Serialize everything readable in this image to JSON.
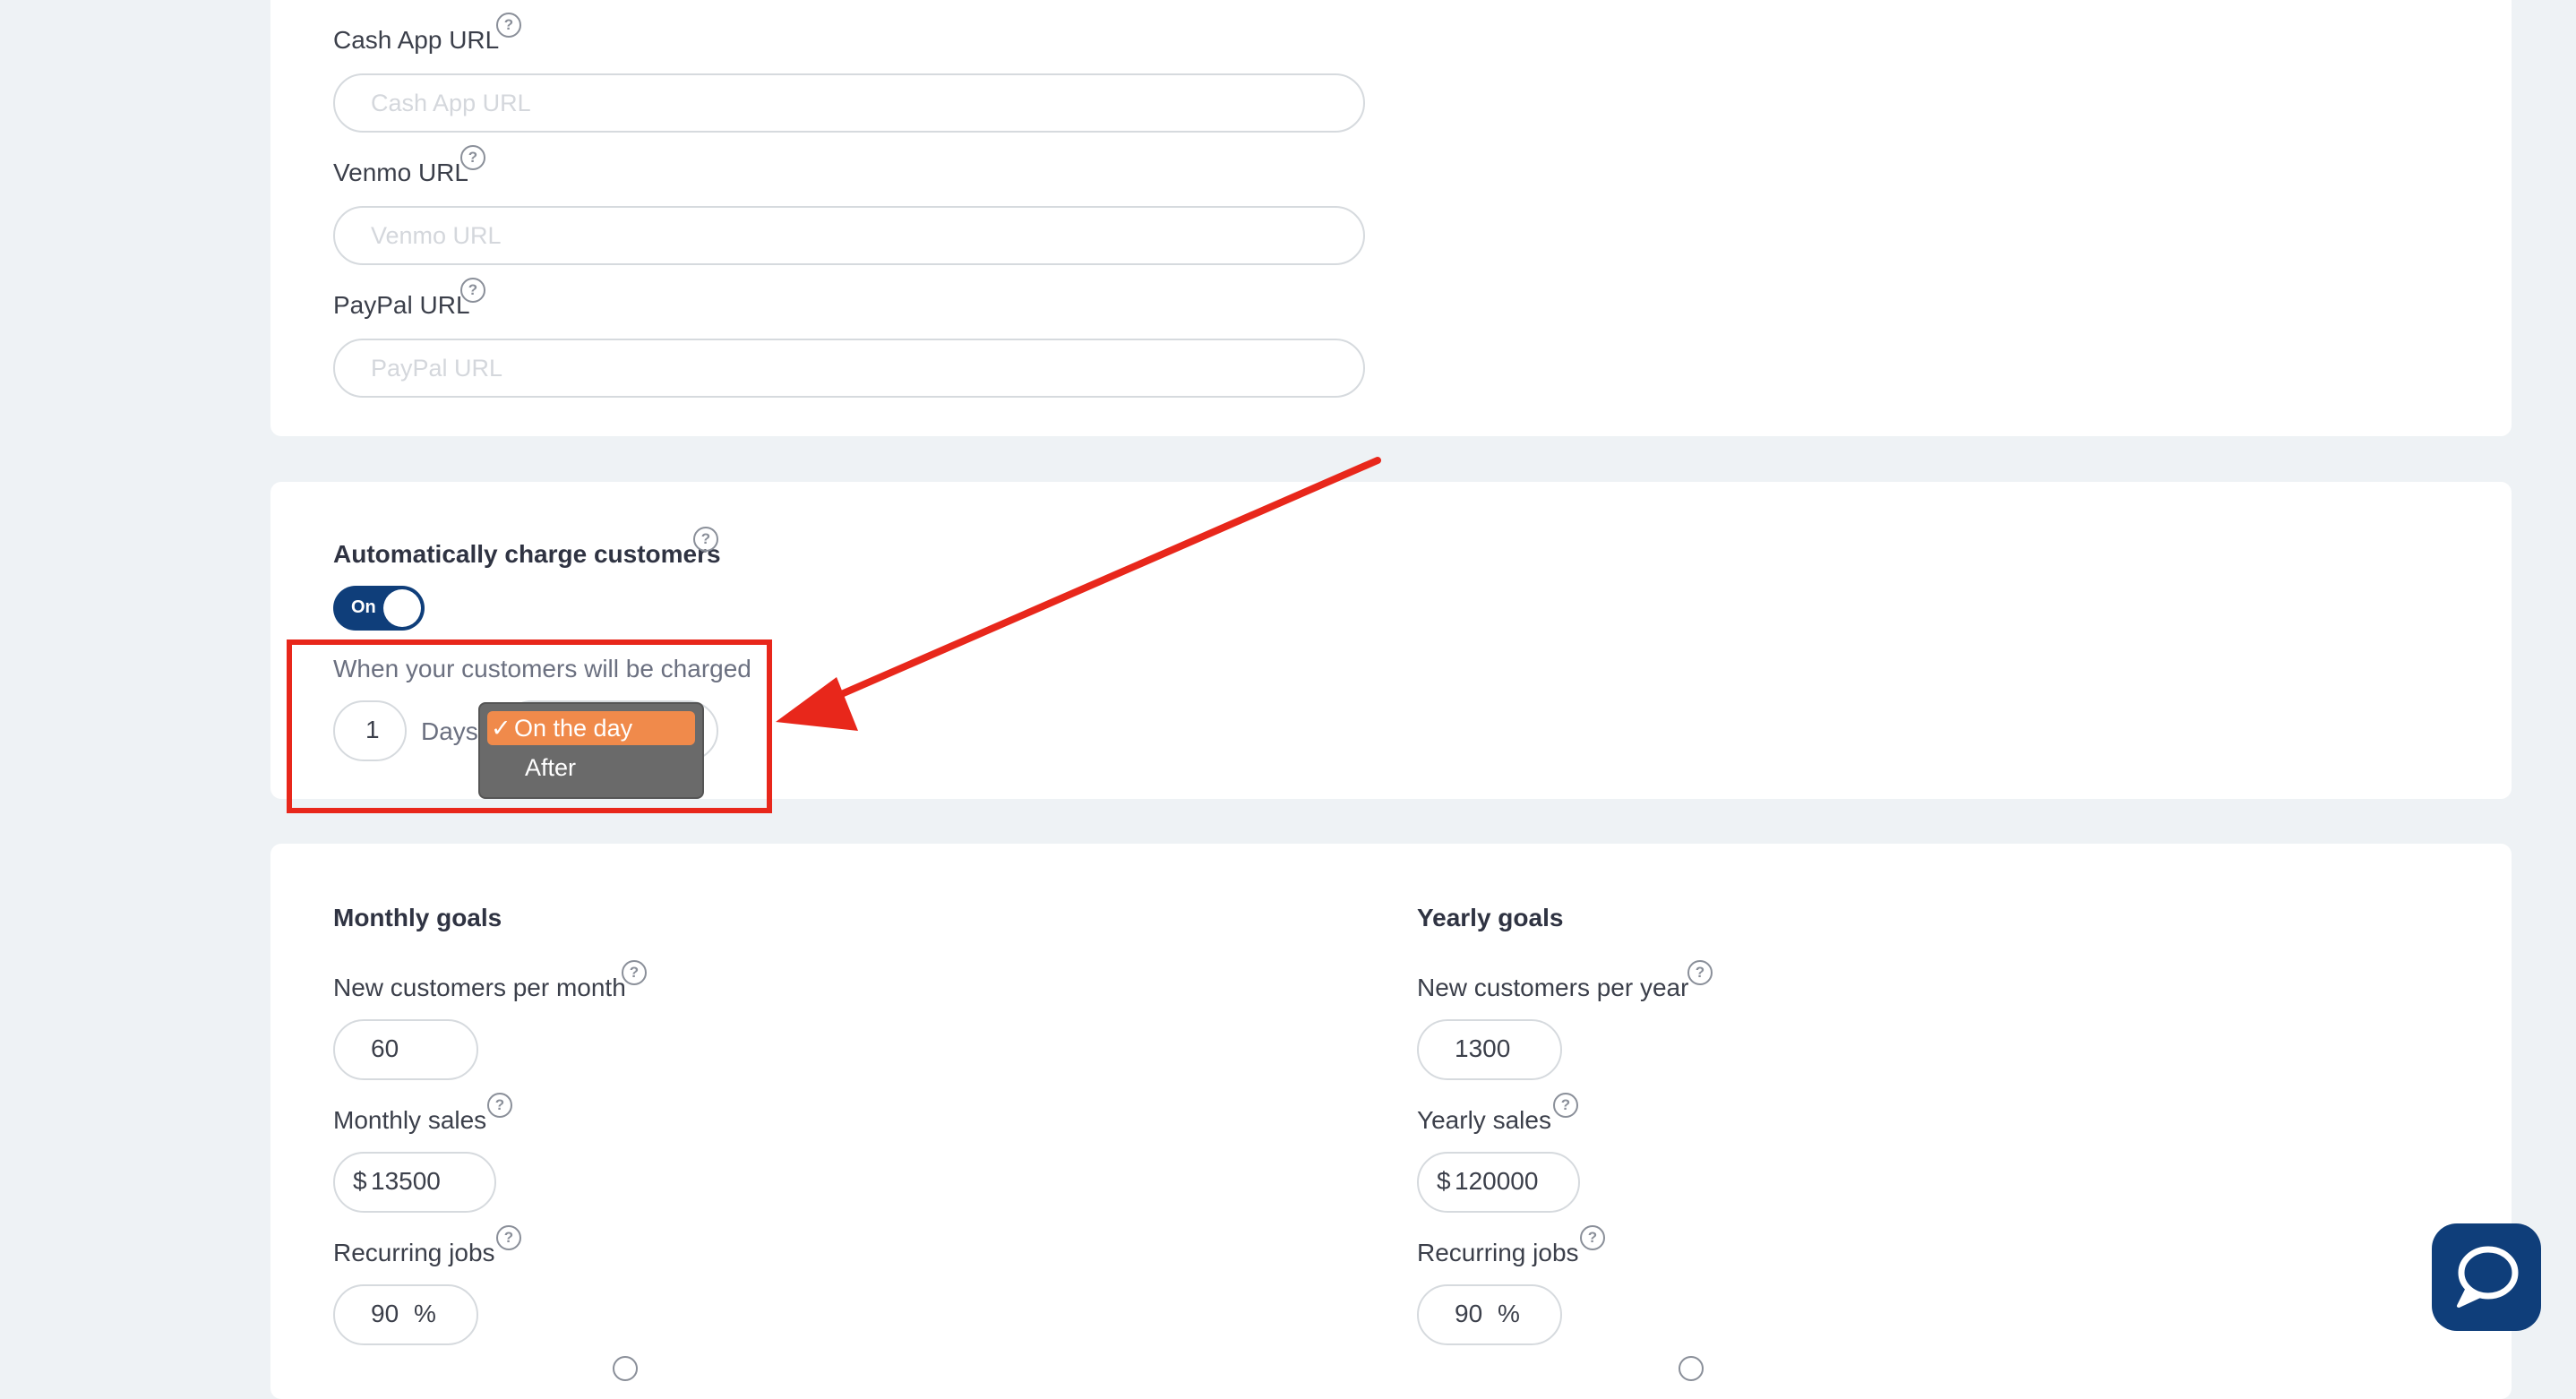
{
  "payment_links": {
    "cashapp": {
      "label": "Cash App URL",
      "placeholder": "Cash App URL",
      "value": ""
    },
    "venmo": {
      "label": "Venmo URL",
      "placeholder": "Venmo URL",
      "value": ""
    },
    "paypal": {
      "label": "PayPal URL",
      "placeholder": "PayPal URL",
      "value": ""
    }
  },
  "help_glyph": "?",
  "auto_charge": {
    "title": "Automatically charge customers",
    "toggle_label": "On",
    "toggle_state": "on",
    "charge_when_label": "When your customers will be charged",
    "days_value": "1",
    "days_label": "Days",
    "dropdown_options": [
      {
        "label": "On the day",
        "check": "✓",
        "selected": true
      },
      {
        "label": "After",
        "selected": false
      }
    ]
  },
  "monthly_goals": {
    "title": "Monthly goals",
    "new_customers": {
      "label": "New customers per month",
      "value": "60"
    },
    "sales": {
      "label": "Monthly sales",
      "prefix": "$",
      "value": "13500"
    },
    "recurring": {
      "label": "Recurring jobs",
      "value": "90",
      "suffix": "%"
    }
  },
  "yearly_goals": {
    "title": "Yearly goals",
    "new_customers": {
      "label": "New customers per year",
      "value": "1300"
    },
    "sales": {
      "label": "Yearly sales",
      "prefix": "$",
      "value": "120000"
    },
    "recurring": {
      "label": "Recurring jobs",
      "value": "90",
      "suffix": "%"
    }
  },
  "chat": {
    "icon": "chat-bubble-icon"
  },
  "colors": {
    "primary": "#0f3e7a",
    "highlight": "#f08a4b",
    "annotation": "#e8271b",
    "background": "#eef2f5"
  }
}
